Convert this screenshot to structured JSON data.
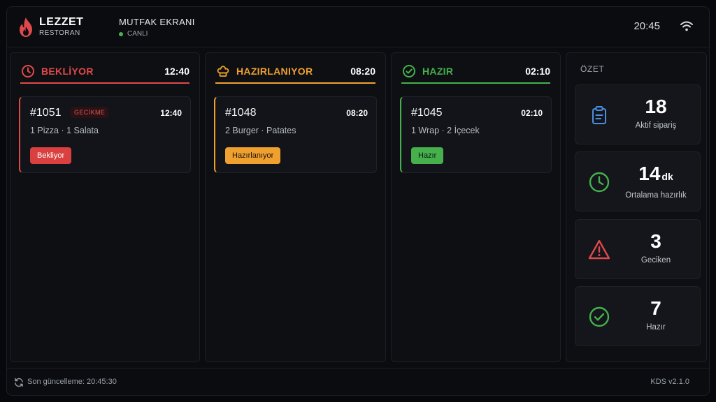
{
  "header": {
    "brand_name": "LEZZET",
    "brand_sub": "RESTORAN",
    "screen_name": "MUTFAK EKRANI",
    "live_label": "CANLI",
    "clock": "20:45"
  },
  "columns": [
    {
      "title": "BEKLİYOR",
      "time": "12:40",
      "color": "#e0494b",
      "icon": "clock-icon",
      "card": {
        "id": "#1051",
        "badge": "GECİKME",
        "time": "12:40",
        "items": "1 Pizza · 1 Salata",
        "status": "Bekliyor"
      }
    },
    {
      "title": "HAZIRLANIYOR",
      "time": "08:20",
      "color": "#f0a02f",
      "icon": "chef-hat-icon",
      "card": {
        "id": "#1048",
        "time": "08:20",
        "items": "2 Burger · Patates",
        "status": "Hazırlanıyor"
      }
    },
    {
      "title": "HAZIR",
      "time": "02:10",
      "color": "#45b04c",
      "icon": "check-circle-icon",
      "card": {
        "id": "#1045",
        "time": "02:10",
        "items": "1 Wrap · 2 İçecek",
        "status": "Hazır"
      }
    }
  ],
  "summary": {
    "title": "ÖZET",
    "stats": [
      {
        "value": "18",
        "unit": "",
        "label": "Aktif sipariş",
        "icon": "clipboard-icon",
        "color": "#4a8fe0"
      },
      {
        "value": "14",
        "unit": "dk",
        "label": "Ortalama hazırlık",
        "icon": "clock-icon",
        "color": "#45b04c"
      },
      {
        "value": "3",
        "unit": "",
        "label": "Geciken",
        "icon": "warning-icon",
        "color": "#e0494b"
      },
      {
        "value": "7",
        "unit": "",
        "label": "Hazır",
        "icon": "check-circle-icon",
        "color": "#45b04c"
      }
    ]
  },
  "footer": {
    "updated": "Son güncelleme: 20:45:30",
    "version": "KDS v2.1.0"
  }
}
